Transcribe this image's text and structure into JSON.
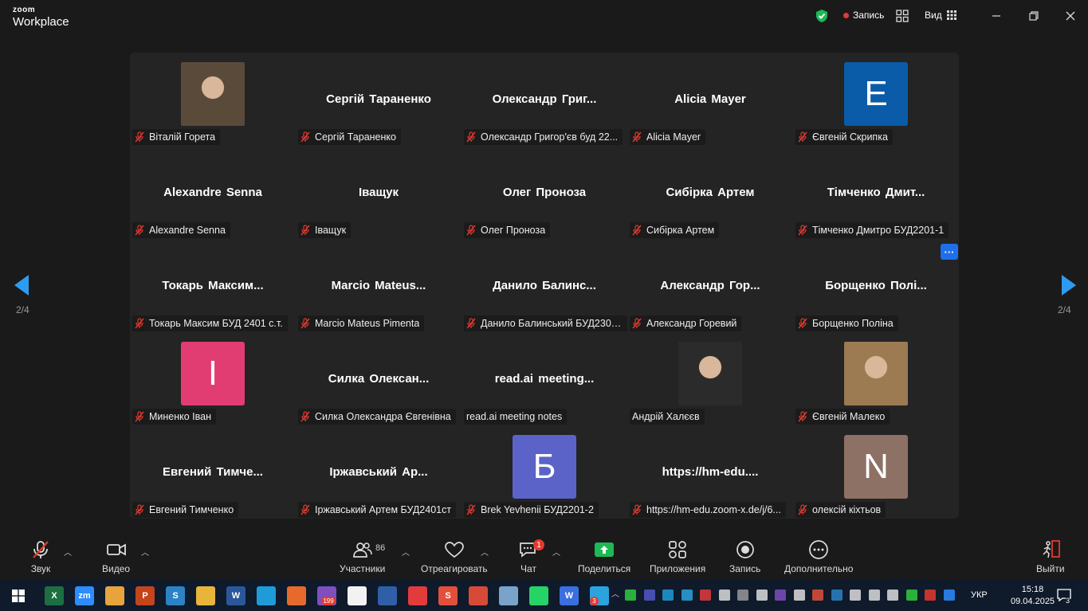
{
  "app": {
    "brand_small": "zoom",
    "brand_name": "Workplace"
  },
  "header": {
    "record_label": "Запись",
    "view_label": "Вид"
  },
  "pager": {
    "left": "2/4",
    "right": "2/4"
  },
  "participants": [
    {
      "big": "",
      "label": "Віталій Горета",
      "avatar": {
        "type": "photo",
        "color": "#5a4a3a"
      }
    },
    {
      "big": "Сергій Тараненко",
      "label": "Сергій Тараненко"
    },
    {
      "big": "Олександр  Григ...",
      "label": "Олександр Григор'єв буд 22..."
    },
    {
      "big": "Alicia Mayer",
      "label": "Alicia Mayer"
    },
    {
      "big": "",
      "label": "Євгеній Скрипка",
      "avatar": {
        "type": "letter",
        "letter": "E",
        "color": "#0a5ca8"
      }
    },
    {
      "big": "Alexandre Senna",
      "label": "Alexandre Senna"
    },
    {
      "big": "Іващук",
      "label": "Іващук"
    },
    {
      "big": "Олег Проноза",
      "label": "Олег Проноза"
    },
    {
      "big": "Сибірка Артем",
      "label": "Сибірка Артем"
    },
    {
      "big": "Тімченко  Дмит...",
      "label": "Тімченко Дмитро БУД2201-1"
    },
    {
      "big": "Токарь  Максим...",
      "label": "Токарь Максим БУД 2401 с.т."
    },
    {
      "big": "Marcio  Mateus...",
      "label": "Marcio Mateus Pimenta"
    },
    {
      "big": "Данило  Балинс...",
      "label": "Данило Балинський БУД2301..."
    },
    {
      "big": "Александр  Гор...",
      "label": "Александр Горевий"
    },
    {
      "big": "Борщенко  Полі...",
      "label": "Борщенко Поліна"
    },
    {
      "big": "",
      "label": "Миненко Іван",
      "avatar": {
        "type": "letter",
        "letter": "I",
        "color": "#e23d72"
      }
    },
    {
      "big": "Силка  Олексан...",
      "label": "Силка Олександра Євгенівна"
    },
    {
      "big": "read.ai  meeting...",
      "label": "read.ai meeting notes",
      "no_mic": true
    },
    {
      "big": "",
      "label": "Андрій Халєєв",
      "no_mic": true,
      "avatar": {
        "type": "photo",
        "color": "#2b2b2b"
      }
    },
    {
      "big": "",
      "label": "Євгеній Малеко",
      "avatar": {
        "type": "photo",
        "color": "#9c7a52"
      }
    },
    {
      "big": "Евгений  Тимче...",
      "label": "Евгений Тимченко"
    },
    {
      "big": "Іржавський  Ар...",
      "label": "Іржавський Артем БУД2401ст"
    },
    {
      "big": "",
      "label": "Brek Yevhenii БУД2201-2",
      "avatar": {
        "type": "letter",
        "letter": "Б",
        "color": "#5b63c9"
      }
    },
    {
      "big": "https://hm-edu....",
      "label": "https://hm-edu.zoom-x.de/j/6..."
    },
    {
      "big": "",
      "label": "олексій кіхтьов",
      "avatar": {
        "type": "letter",
        "letter": "N",
        "color": "#8c7164"
      }
    }
  ],
  "toolbar": {
    "audio": "Звук",
    "video": "Видео",
    "participants": "Участники",
    "participants_count": "86",
    "react": "Отреагировать",
    "chat": "Чат",
    "chat_badge": "1",
    "share": "Поделиться",
    "apps": "Приложения",
    "record": "Запись",
    "more": "Дополнительно",
    "leave": "Выйти"
  },
  "taskbar": {
    "lang": "УКР",
    "time": "15:18",
    "date": "09.04.2025",
    "viber_badge": "199",
    "telegram_badge": "3",
    "notif_badge": "3",
    "apps": [
      {
        "name": "excel",
        "glyph": "X",
        "color": "#1d6f42"
      },
      {
        "name": "zoom",
        "glyph": "zm",
        "color": "#2d8cff"
      },
      {
        "name": "chrome",
        "glyph": "",
        "color": "#e8a33c"
      },
      {
        "name": "powerpoint",
        "glyph": "P",
        "color": "#c4441c"
      },
      {
        "name": "app-s",
        "glyph": "S",
        "color": "#2b83c6"
      },
      {
        "name": "explorer",
        "glyph": "",
        "color": "#e8b53a"
      },
      {
        "name": "word",
        "glyph": "W",
        "color": "#2b579a"
      },
      {
        "name": "edge",
        "glyph": "",
        "color": "#1f9cd7"
      },
      {
        "name": "firefox",
        "glyph": "",
        "color": "#e66a2c"
      },
      {
        "name": "viber",
        "glyph": "",
        "color": "#7d4fbf"
      },
      {
        "name": "notepad",
        "glyph": "",
        "color": "#f2f2f2"
      },
      {
        "name": "floppy",
        "glyph": "",
        "color": "#2f5fa8"
      },
      {
        "name": "anydesk",
        "glyph": "",
        "color": "#e23b3b"
      },
      {
        "name": "app-s2",
        "glyph": "S",
        "color": "#e2503b"
      },
      {
        "name": "chrome-n",
        "glyph": "",
        "color": "#d84a38"
      },
      {
        "name": "app-map",
        "glyph": "",
        "color": "#7aa3c9"
      },
      {
        "name": "whatsapp",
        "glyph": "",
        "color": "#25d366"
      },
      {
        "name": "app-w",
        "glyph": "W",
        "color": "#3b6fe0"
      },
      {
        "name": "telegram",
        "glyph": "",
        "color": "#2aa3de"
      }
    ]
  }
}
